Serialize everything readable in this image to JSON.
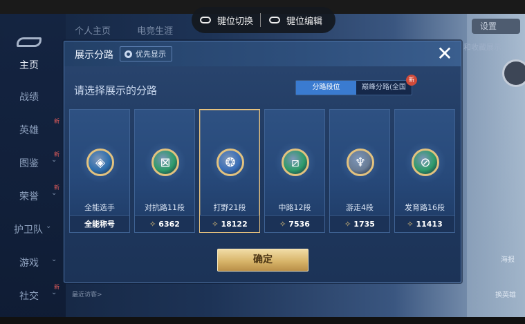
{
  "toolbar": {
    "key_switch_label": "键位切换",
    "key_edit_label": "键位编辑"
  },
  "background": {
    "nav_items": [
      {
        "label": "主页",
        "active": true
      },
      {
        "label": "战绩"
      },
      {
        "label": "英雄",
        "new": "新"
      },
      {
        "label": "图鉴",
        "chevron": "⌄",
        "new": "新"
      },
      {
        "label": "荣誉",
        "chevron": "⌄",
        "new": "新"
      },
      {
        "label": "护卫队",
        "chevron": "⌄"
      },
      {
        "label": "游戏",
        "chevron": "⌄"
      },
      {
        "label": "社交",
        "chevron": "⌄",
        "new": "新"
      }
    ],
    "top_tabs": [
      "个人主页",
      "电竞生涯"
    ],
    "settings_label": "设置",
    "hint_text": "和收藏展示",
    "side_labels": [
      "海报",
      "换英雄"
    ],
    "recent_visitors_label": "最近访客>"
  },
  "modal": {
    "title": "展示分路",
    "priority_button_label": "优先显示",
    "close_glyph": "✕",
    "subtitle": "请选择展示的分路",
    "segment": {
      "options": [
        {
          "label": "分路段位",
          "selected": true
        },
        {
          "label": "巅峰分路(全国",
          "new_badge": "新"
        }
      ]
    },
    "cards": [
      {
        "name": "全能选手",
        "footer": "全能称号",
        "icon": "all-round-icon",
        "glyph": "◈",
        "color": "#2f6fae",
        "has_points": false,
        "selected": false
      },
      {
        "name": "对抗路11段",
        "footer": "6362",
        "icon": "clash-lane-icon",
        "glyph": "⊠",
        "color": "#2f9b6a",
        "has_points": true,
        "selected": false
      },
      {
        "name": "打野21段",
        "footer": "18122",
        "icon": "jungle-icon",
        "glyph": "❂",
        "color": "#3b6fb8",
        "has_points": true,
        "selected": true
      },
      {
        "name": "中路12段",
        "footer": "7536",
        "icon": "mid-lane-icon",
        "glyph": "⧄",
        "color": "#2f9b6a",
        "has_points": true,
        "selected": false
      },
      {
        "name": "游走4段",
        "footer": "1735",
        "icon": "roam-icon",
        "glyph": "♆",
        "color": "#6a7d96",
        "has_points": true,
        "selected": false
      },
      {
        "name": "发育路16段",
        "footer": "11413",
        "icon": "farm-lane-icon",
        "glyph": "⊘",
        "color": "#2f9b6a",
        "has_points": true,
        "selected": false
      }
    ],
    "points_glyph": "✧",
    "confirm_label": "确定"
  }
}
